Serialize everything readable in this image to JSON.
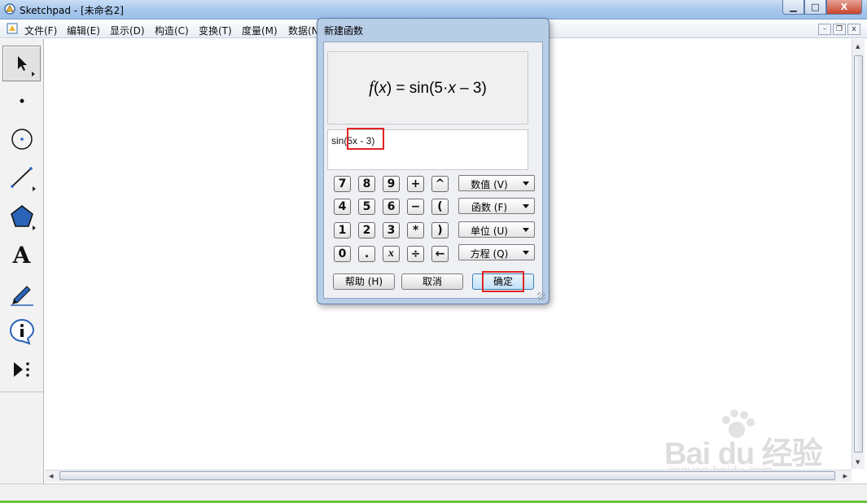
{
  "window": {
    "title": "Sketchpad  - [未命名2]",
    "controls": {
      "minimize": "▁",
      "maximize": "□",
      "close": "X"
    }
  },
  "menubar": {
    "items": [
      {
        "label": "文件(F)"
      },
      {
        "label": "编辑(E)"
      },
      {
        "label": "显示(D)"
      },
      {
        "label": "构造(C)"
      },
      {
        "label": "变换(T)"
      },
      {
        "label": "度量(M)"
      },
      {
        "label": "数据(N"
      }
    ],
    "doc_controls": {
      "minimize": "–",
      "restore": "❐",
      "close": "x"
    }
  },
  "toolbox": {
    "tools": [
      {
        "name": "selection-arrow-tool",
        "icon": "arrow-pointer-icon",
        "active": true
      },
      {
        "name": "point-tool",
        "icon": "point-icon"
      },
      {
        "name": "compass-tool",
        "icon": "circle-icon"
      },
      {
        "name": "straightedge-tool",
        "icon": "line-segment-icon"
      },
      {
        "name": "polygon-tool",
        "icon": "pentagon-icon"
      },
      {
        "name": "text-tool",
        "icon": "text-a-icon",
        "glyph": "A"
      },
      {
        "name": "marker-tool",
        "icon": "pen-icon"
      },
      {
        "name": "information-tool",
        "icon": "info-icon",
        "glyph": "i"
      },
      {
        "name": "custom-tool",
        "icon": "play-more-icon"
      }
    ]
  },
  "dialog": {
    "title": "新建函数",
    "preview": "f(x) = sin(5·x – 3)",
    "expression": "sin(5x - 3)",
    "keypad": {
      "rows": [
        [
          "7",
          "8",
          "9",
          "+",
          "^"
        ],
        [
          "4",
          "5",
          "6",
          "−",
          "("
        ],
        [
          "1",
          "2",
          "3",
          "*",
          ")"
        ],
        [
          "0",
          ".",
          "x",
          "÷",
          "←"
        ]
      ]
    },
    "dropdowns": [
      {
        "label": "数值 (V)"
      },
      {
        "label": "函数 (F)"
      },
      {
        "label": "单位 (U)"
      },
      {
        "label": "方程 (Q)"
      }
    ],
    "buttons": {
      "help": "帮助 (H)",
      "cancel": "取消",
      "ok": "确定"
    }
  },
  "watermark": {
    "brand": "Bai du 经验",
    "url": "jingyan.baidu.com"
  },
  "colors": {
    "highlight": "#e02424",
    "titlebar": "#a9c8ec",
    "dialog_frame": "#b8cde6"
  }
}
